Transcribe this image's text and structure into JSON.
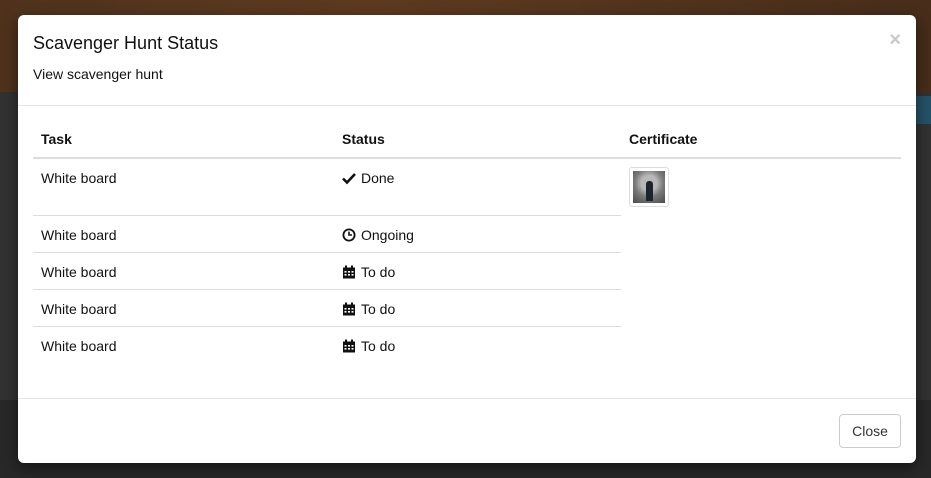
{
  "modal": {
    "title": "Scavenger Hunt Status",
    "subtitle": "View scavenger hunt",
    "close_icon": "×",
    "close_button": "Close"
  },
  "table": {
    "headers": [
      "Task",
      "Status",
      "Certificate"
    ],
    "rows": [
      {
        "task": "White board",
        "status": "Done",
        "status_icon": "check-icon"
      },
      {
        "task": "White board",
        "status": "Ongoing",
        "status_icon": "clock-icon"
      },
      {
        "task": "White board",
        "status": "To do",
        "status_icon": "calendar-icon"
      },
      {
        "task": "White board",
        "status": "To do",
        "status_icon": "calendar-icon"
      },
      {
        "task": "White board",
        "status": "To do",
        "status_icon": "calendar-icon"
      }
    ]
  },
  "colors": {
    "header_border": "#dddddd",
    "close_x": "#c8c8c8"
  }
}
